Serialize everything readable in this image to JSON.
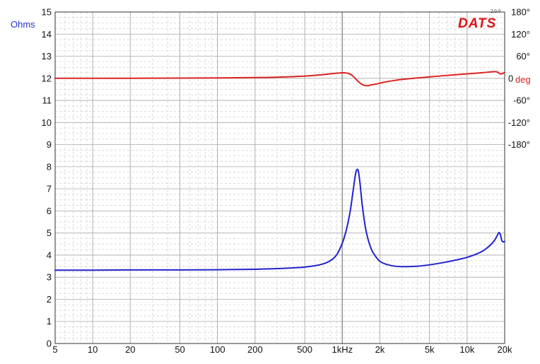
{
  "chart_data": {
    "type": "line",
    "brand": "DATS",
    "version": "2.0.0",
    "ylabel_left": "Ohms",
    "ylabel_right": "deg",
    "xscale": "log",
    "xlim": [
      5,
      20000
    ],
    "ylim": [
      0,
      15
    ],
    "grid": true,
    "x_ticks": [
      {
        "value": 5,
        "label": "5"
      },
      {
        "value": 10,
        "label": "10"
      },
      {
        "value": 20,
        "label": "20"
      },
      {
        "value": 50,
        "label": "50"
      },
      {
        "value": 100,
        "label": "100"
      },
      {
        "value": 200,
        "label": "200"
      },
      {
        "value": 500,
        "label": "500"
      },
      {
        "value": 1000,
        "label": "1kHz"
      },
      {
        "value": 2000,
        "label": "2k"
      },
      {
        "value": 5000,
        "label": "5k"
      },
      {
        "value": 10000,
        "label": "10k"
      },
      {
        "value": 20000,
        "label": "20k"
      }
    ],
    "y_ticks": [
      {
        "value": 0,
        "label": "0"
      },
      {
        "value": 1,
        "label": "1"
      },
      {
        "value": 2,
        "label": "2"
      },
      {
        "value": 3,
        "label": "3"
      },
      {
        "value": 4,
        "label": "4"
      },
      {
        "value": 5,
        "label": "5"
      },
      {
        "value": 6,
        "label": "6"
      },
      {
        "value": 7,
        "label": "7"
      },
      {
        "value": 8,
        "label": "8"
      },
      {
        "value": 9,
        "label": "9"
      },
      {
        "value": 10,
        "label": "10"
      },
      {
        "value": 11,
        "label": "11"
      },
      {
        "value": 12,
        "label": "12"
      },
      {
        "value": 13,
        "label": "13"
      },
      {
        "value": 14,
        "label": "14"
      },
      {
        "value": 15,
        "label": "15"
      }
    ],
    "phase_ticks": [
      {
        "deg": 180,
        "label": "180°"
      },
      {
        "deg": 120,
        "label": "120°"
      },
      {
        "deg": 60,
        "label": "60°"
      },
      {
        "deg": 0,
        "label": "0"
      },
      {
        "deg": -60,
        "label": "-60°"
      },
      {
        "deg": -120,
        "label": "-120°"
      },
      {
        "deg": -180,
        "label": "-180°"
      }
    ],
    "series": [
      {
        "name": "impedance",
        "color": "#2222cc",
        "axis": "ohms",
        "x": [
          5,
          10,
          20,
          50,
          100,
          200,
          300,
          500,
          700,
          850,
          950,
          1050,
          1150,
          1220,
          1280,
          1320,
          1350,
          1390,
          1450,
          1550,
          1700,
          1900,
          2100,
          2500,
          3000,
          4000,
          5000,
          7000,
          10000,
          13000,
          15000,
          16500,
          17500,
          18000,
          18500,
          19000,
          19500,
          20000
        ],
        "values": [
          3.32,
          3.32,
          3.33,
          3.33,
          3.34,
          3.36,
          3.39,
          3.46,
          3.6,
          3.85,
          4.25,
          4.9,
          5.9,
          6.9,
          7.7,
          7.88,
          7.75,
          7.2,
          6.2,
          5.1,
          4.3,
          3.85,
          3.65,
          3.52,
          3.48,
          3.5,
          3.56,
          3.7,
          3.9,
          4.15,
          4.4,
          4.65,
          4.9,
          5.02,
          4.92,
          4.65,
          4.6,
          4.62
        ]
      },
      {
        "name": "phase",
        "color": "#dd2222",
        "axis": "deg",
        "x": [
          5,
          10,
          20,
          50,
          100,
          200,
          300,
          500,
          700,
          850,
          1000,
          1100,
          1200,
          1300,
          1400,
          1500,
          1600,
          1700,
          1900,
          2200,
          2600,
          3000,
          4000,
          5000,
          7000,
          10000,
          13000,
          15000,
          16500,
          17500,
          18500,
          19500,
          20000
        ],
        "values": [
          0,
          0,
          0.2,
          0.5,
          1,
          2,
          3,
          6,
          10,
          13,
          15,
          14,
          8,
          -4,
          -14,
          -19,
          -20,
          -18,
          -15,
          -10,
          -6,
          -3,
          1,
          4,
          8,
          12,
          15,
          17,
          18,
          17,
          12,
          14,
          16
        ]
      }
    ]
  }
}
